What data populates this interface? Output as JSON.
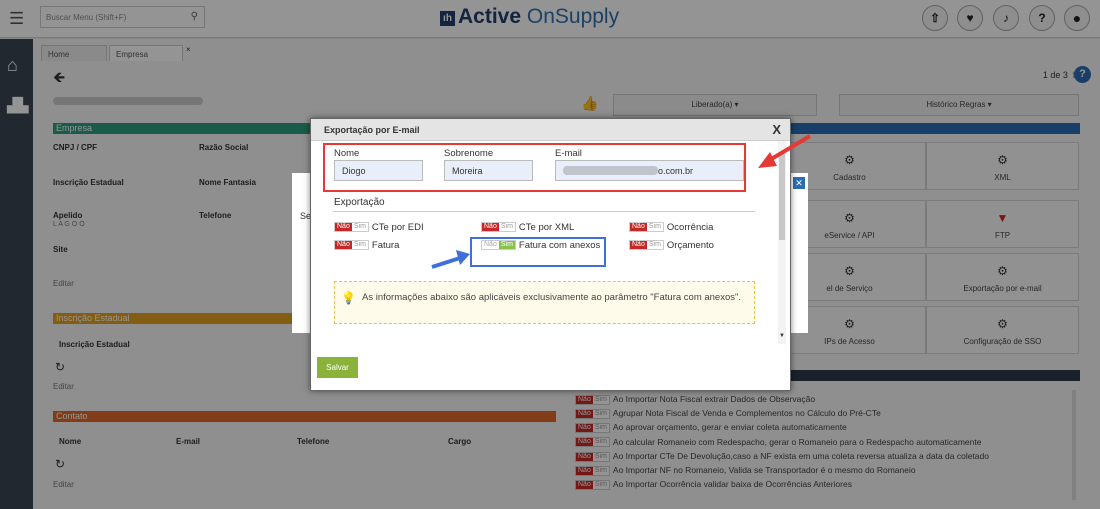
{
  "topbar": {
    "search_placeholder": "Buscar Menu  (Shift+F)",
    "logo_bold": "Active",
    "logo_light": " OnSupply",
    "logo_mark": "ıh"
  },
  "tabs": {
    "home": "Home",
    "empresa": "Empresa",
    "close": "×"
  },
  "pager": {
    "text": "1 de 3"
  },
  "nav": {
    "liberado": "Liberado(a) ▾",
    "historico": "Histórico Regras ▾"
  },
  "sections": {
    "empresa": "Empresa",
    "inscricao": "Inscrição Estadual",
    "contato": "Contato"
  },
  "colors": {
    "empresa": "#2e9e7e",
    "inscricao": "#e0a020",
    "contato": "#e06a2a",
    "header_dark": "#2e3a4a",
    "accent": "#2a6db5"
  },
  "fields": {
    "cnpj": "CNPJ / CPF",
    "razao": "Razão Social",
    "inscricao_est": "Inscrição Estadual",
    "nome_fantasia": "Nome Fantasia",
    "apelido": "Apelido",
    "apelido_val": "L A G O O",
    "telefone": "Telefone",
    "site": "Site",
    "editar": "Editar",
    "ins_col": "Inscrição Estadual",
    "contato_cols": [
      "Nome",
      "E-mail",
      "Telefone",
      "Cargo"
    ]
  },
  "tiles": {
    "cadastro": "Cadastro",
    "xml": "XML",
    "webservice": "eService / API",
    "ftp": "FTP",
    "nivel": "el de Serviço",
    "export_email": "Exportação por e-mail",
    "ips": "IPs de Acesso",
    "sso": "Configuração de SSO"
  },
  "rules": [
    "Ao Importar Nota Fiscal extrair Dados de Observação",
    "Agrupar Nota Fiscal de Venda e Complementos no Cálculo do Pré-CTe",
    "Ao aprovar orçamento, gerar e enviar coleta automaticamente",
    "Ao calcular Romaneio com Redespacho, gerar o Romaneio para o Redespacho automaticamente",
    "Ao Importar CTe De Devolução,caso a NF exista em uma coleta reversa atualiza a data da coletado",
    "Ao Importar NF no Romaneio, Valida se Transportador é o mesmo do Romaneio",
    "Ao Importar Ocorrência validar baixa de Ocorrências Anteriores"
  ],
  "toggle": {
    "nao": "Não",
    "sim": "Sim"
  },
  "dialog_behind": {
    "text": "Se"
  },
  "modal": {
    "title": "Exportação por E-mail",
    "close": "X",
    "nome_label": "Nome",
    "nome_value": "Diogo",
    "sobrenome_label": "Sobrenome",
    "sobrenome_value": "Moreira",
    "email_label": "E-mail",
    "email_suffix": "o.com.br",
    "section": "Exportação",
    "options": [
      "CTe por EDI",
      "CTe por XML",
      "Ocorrência",
      "Fatura",
      "Fatura com anexos",
      "Orçamento"
    ],
    "info": "As informações abaixo são aplicáveis exclusivamente ao parâmetro \"Fatura com anexos\".",
    "save": "Salvar"
  }
}
